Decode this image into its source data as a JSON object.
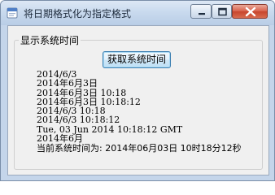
{
  "window": {
    "title": "将日期格式化为指定格式",
    "icon": "winforms-app-icon",
    "controls": {
      "minimize_icon": "minimize-icon",
      "maximize_icon": "maximize-icon",
      "close_icon": "close-icon",
      "close_color": "#c7442c"
    }
  },
  "groupbox": {
    "label": "显示系统时间"
  },
  "button": {
    "label": "获取系统时间"
  },
  "output_lines": [
    "2014/6/3",
    "2014年6月3日",
    "2014年6月3日  10:18",
    "2014年6月3日  10:18:12",
    "2014/6/3 10:18",
    "2014/6/3 10:18:12",
    "Tue, 03 Jun 2014 10:18:12 GMT",
    "2014年6月",
    "当前系统时间为: 2014年06月03日  10时18分12秒"
  ]
}
